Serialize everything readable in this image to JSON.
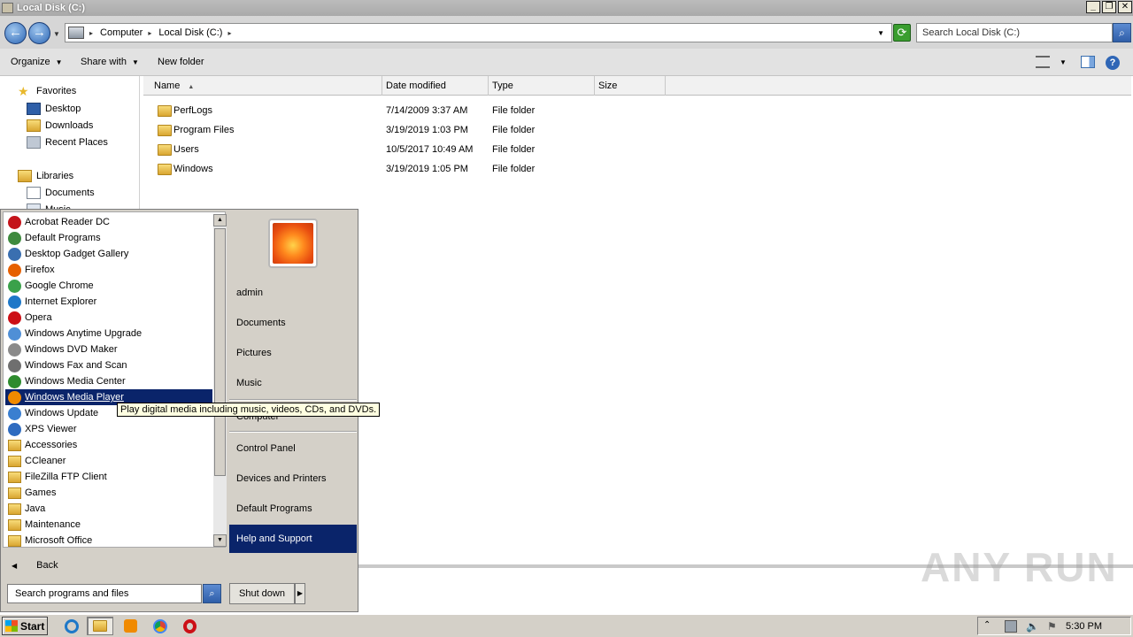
{
  "window": {
    "title": "Local Disk (C:)",
    "buttons": {
      "minimize": "_",
      "maximize": "❐",
      "close": "✕"
    }
  },
  "address": {
    "breadcrumbs": [
      "Computer",
      "Local Disk (C:)"
    ],
    "search_placeholder": "Search Local Disk (C:)"
  },
  "toolbar": {
    "organize": "Organize",
    "share_with": "Share with",
    "new_folder": "New folder"
  },
  "nav": {
    "favorites": "Favorites",
    "desktop": "Desktop",
    "downloads": "Downloads",
    "recent_places": "Recent Places",
    "libraries": "Libraries",
    "documents": "Documents",
    "music": "Music"
  },
  "columns": {
    "name": "Name",
    "date": "Date modified",
    "type": "Type",
    "size": "Size"
  },
  "files": [
    {
      "name": "PerfLogs",
      "date": "7/14/2009 3:37 AM",
      "type": "File folder"
    },
    {
      "name": "Program Files",
      "date": "3/19/2019 1:03 PM",
      "type": "File folder"
    },
    {
      "name": "Users",
      "date": "10/5/2017 10:49 AM",
      "type": "File folder"
    },
    {
      "name": "Windows",
      "date": "3/19/2019 1:05 PM",
      "type": "File folder"
    }
  ],
  "start_menu": {
    "programs": [
      {
        "label": "Acrobat Reader DC",
        "icon": "acrobat-icon",
        "color": "#c4141a"
      },
      {
        "label": "Default Programs",
        "icon": "default-programs-icon",
        "color": "#3e8a3e"
      },
      {
        "label": "Desktop Gadget Gallery",
        "icon": "gadget-icon",
        "color": "#3a6fb0"
      },
      {
        "label": "Firefox",
        "icon": "firefox-icon",
        "color": "#e66000"
      },
      {
        "label": "Google Chrome",
        "icon": "chrome-icon",
        "color": "#3aa14a"
      },
      {
        "label": "Internet Explorer",
        "icon": "ie-icon",
        "color": "#1e78c8"
      },
      {
        "label": "Opera",
        "icon": "opera-icon",
        "color": "#cc0f16"
      },
      {
        "label": "Windows Anytime Upgrade",
        "icon": "upgrade-icon",
        "color": "#4f8fd6"
      },
      {
        "label": "Windows DVD Maker",
        "icon": "dvd-icon",
        "color": "#8a8a8a"
      },
      {
        "label": "Windows Fax and Scan",
        "icon": "fax-icon",
        "color": "#6f6f6f"
      },
      {
        "label": "Windows Media Center",
        "icon": "media-center-icon",
        "color": "#2e8b2e"
      },
      {
        "label": "Windows Media Player",
        "icon": "media-player-icon",
        "color": "#f08a00"
      },
      {
        "label": "Windows Update",
        "icon": "windows-update-icon",
        "color": "#3a7fd0"
      },
      {
        "label": "XPS Viewer",
        "icon": "xps-icon",
        "color": "#2e6bc0"
      },
      {
        "label": "Accessories",
        "icon": "folder-icon",
        "color": "#e0b23a"
      },
      {
        "label": "CCleaner",
        "icon": "folder-icon",
        "color": "#e0b23a"
      },
      {
        "label": "FileZilla FTP Client",
        "icon": "folder-icon",
        "color": "#e0b23a"
      },
      {
        "label": "Games",
        "icon": "folder-icon",
        "color": "#e0b23a"
      },
      {
        "label": "Java",
        "icon": "folder-icon",
        "color": "#e0b23a"
      },
      {
        "label": "Maintenance",
        "icon": "folder-icon",
        "color": "#e0b23a"
      },
      {
        "label": "Microsoft Office",
        "icon": "folder-icon",
        "color": "#e0b23a"
      }
    ],
    "selected_index": 11,
    "back": "Back",
    "search_placeholder": "Search programs and files",
    "right": {
      "user": "admin",
      "documents": "Documents",
      "pictures": "Pictures",
      "music": "Music",
      "computer": "Computer",
      "control_panel": "Control Panel",
      "devices_printers": "Devices and Printers",
      "default_programs": "Default Programs",
      "help_support": "Help and Support"
    },
    "shutdown": "Shut down",
    "tooltip": "Play digital media including music, videos, CDs, and DVDs."
  },
  "taskbar": {
    "start": "Start",
    "clock": "5:30 PM"
  },
  "watermark": "ANY RUN"
}
